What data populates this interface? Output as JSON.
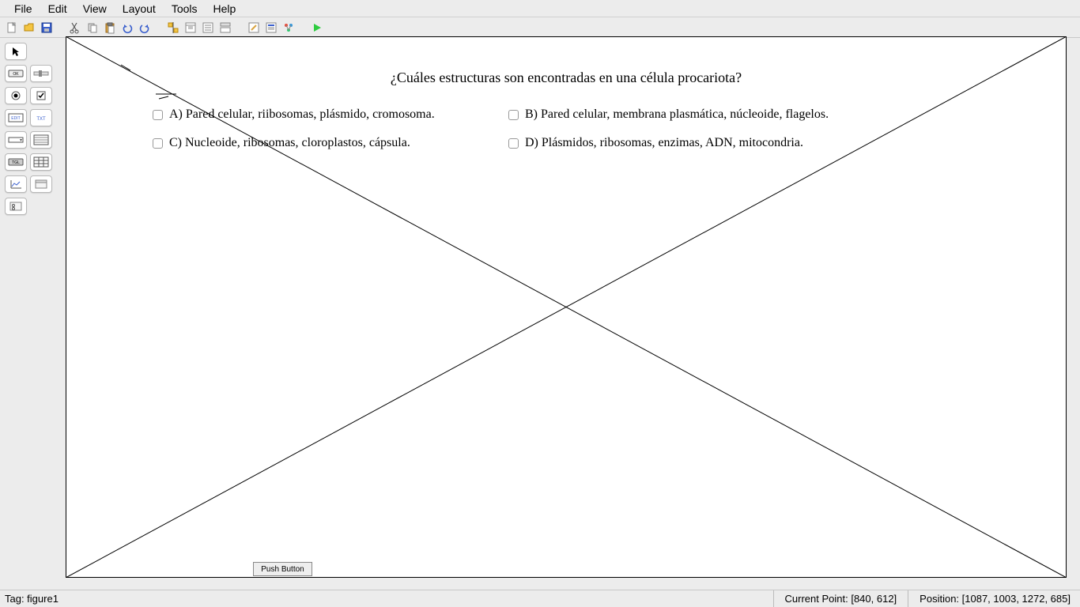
{
  "menubar": {
    "items": [
      "File",
      "Edit",
      "View",
      "Layout",
      "Tools",
      "Help"
    ]
  },
  "canvas": {
    "question": "¿Cuáles estructuras son encontradas en una célula procariota?",
    "options": {
      "a": "A) Pared celular, riibosomas, plásmido, cromosoma.",
      "b": "B) Pared celular, membrana plasmática, núcleoide, flagelos.",
      "c": "C) Nucleoide, ribosomas, cloroplastos, cápsula.",
      "d": "D) Plásmidos, ribosomas, enzimas, ADN, mitocondria."
    },
    "push_button_label": "Push Button"
  },
  "statusbar": {
    "tag_label": "Tag: figure1",
    "current_point_label": "Current Point:  [840, 612]",
    "position_label": "Position: [1087, 1003, 1272, 685]"
  }
}
